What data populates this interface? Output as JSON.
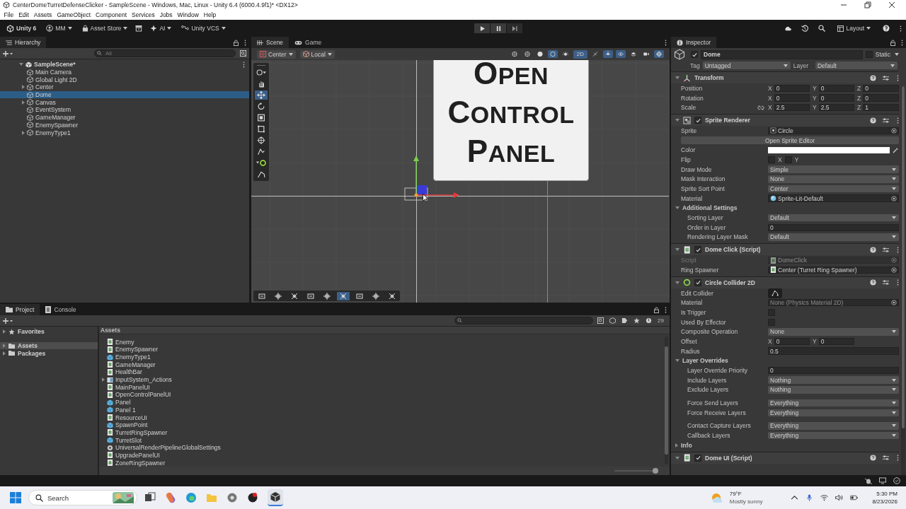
{
  "window": {
    "title": "CenterDomeTurretDefenseClicker - SampleScene - Windows, Mac, Linux - Unity 6.4 (6000.4.9f1)* <DX12>"
  },
  "menu": [
    "File",
    "Edit",
    "Assets",
    "GameObject",
    "Component",
    "Services",
    "Jobs",
    "Window",
    "Help"
  ],
  "toolbar": {
    "product": "Unity 6",
    "account": "MM",
    "asset_store": "Asset Store",
    "ai": "AI",
    "vcs": "Unity VCS",
    "layout": "Layout"
  },
  "hierarchy": {
    "tab": "Hierarchy",
    "search_placeholder": "All",
    "scene": "SampleScene*",
    "items": [
      {
        "name": "Main Camera",
        "selected": false,
        "expandable": false
      },
      {
        "name": "Global Light 2D",
        "selected": false,
        "expandable": false
      },
      {
        "name": "Center",
        "selected": false,
        "expandable": true
      },
      {
        "name": "Dome",
        "selected": true,
        "expandable": false
      },
      {
        "name": "Canvas",
        "selected": false,
        "expandable": true
      },
      {
        "name": "EventSystem",
        "selected": false,
        "expandable": false
      },
      {
        "name": "GameManager",
        "selected": false,
        "expandable": false
      },
      {
        "name": "EnemySpawner",
        "selected": false,
        "expandable": false
      },
      {
        "name": "EnemyType1",
        "selected": false,
        "expandable": true
      }
    ]
  },
  "scene": {
    "tabs": [
      {
        "label": "Scene",
        "selected": true
      },
      {
        "label": "Game",
        "selected": false
      }
    ],
    "pivot": "Center",
    "space": "Local",
    "mode": "2D",
    "sign_lines": [
      "OPEN",
      "CONTROL",
      "PANEL"
    ]
  },
  "inspector": {
    "tab": "Inspector",
    "object": {
      "name": "Dome",
      "active": true,
      "static_label": "Static",
      "static": false
    },
    "tag_label": "Tag",
    "tag": "Untagged",
    "layer_label": "Layer",
    "layer": "Default",
    "components": [
      {
        "kind": "transform",
        "title": "Transform",
        "rows": [
          {
            "kind": "vector",
            "label": "Position",
            "values": [
              {
                "axis": "X",
                "value": "0"
              },
              {
                "axis": "Y",
                "value": "0"
              },
              {
                "axis": "Z",
                "value": "0"
              }
            ]
          },
          {
            "kind": "vector",
            "label": "Rotation",
            "values": [
              {
                "axis": "X",
                "value": "0"
              },
              {
                "axis": "Y",
                "value": "0"
              },
              {
                "axis": "Z",
                "value": "0"
              }
            ]
          },
          {
            "kind": "vector",
            "label": "Scale",
            "constrained": false,
            "values": [
              {
                "axis": "X",
                "value": "2.5"
              },
              {
                "axis": "Y",
                "value": "2.5"
              },
              {
                "axis": "Z",
                "value": "1"
              }
            ]
          }
        ]
      },
      {
        "kind": "sprite_renderer",
        "title": "Sprite Renderer",
        "enabled": true,
        "rows": [
          {
            "kind": "sprite_ref",
            "label": "Sprite",
            "value": "Circle"
          },
          {
            "kind": "button",
            "label": "Open Sprite Editor"
          },
          {
            "kind": "color",
            "label": "Color",
            "color": "#ffffff"
          },
          {
            "kind": "flip",
            "label": "Flip",
            "values": [
              {
                "axis": "X",
                "checked": false
              },
              {
                "axis": "Y",
                "checked": false
              }
            ]
          },
          {
            "kind": "dropdown",
            "label": "Draw Mode",
            "value": "Simple"
          },
          {
            "kind": "dropdown",
            "label": "Mask Interaction",
            "value": "None"
          },
          {
            "kind": "dropdown",
            "label": "Sprite Sort Point",
            "value": "Center"
          },
          {
            "kind": "material_ref",
            "label": "Material",
            "value": "Sprite-Lit-Default"
          },
          {
            "kind": "foldout",
            "label": "Additional Settings",
            "expanded": true,
            "children": [
              {
                "kind": "dropdown",
                "label": "Sorting Layer",
                "value": "Default"
              },
              {
                "kind": "field",
                "label": "Order in Layer",
                "value": "0"
              },
              {
                "kind": "dropdown",
                "label": "Rendering Layer Mask",
                "value": "Default"
              }
            ]
          }
        ]
      },
      {
        "kind": "script",
        "title": "Dome Click (Script)",
        "enabled": true,
        "rows": [
          {
            "kind": "script_ref",
            "label": "Script",
            "value": "DomeClick",
            "disabled": true
          },
          {
            "kind": "script_ref",
            "label": "Ring Spawner",
            "value": "Center (Turret Ring Spawner)",
            "disabled": false
          }
        ]
      },
      {
        "kind": "collider",
        "title": "Circle Collider 2D",
        "enabled": true,
        "rows": [
          {
            "kind": "edit_collider",
            "label": "Edit Collider"
          },
          {
            "kind": "empty_ref",
            "label": "Material",
            "placeholder": "None (Physics Material 2D)"
          },
          {
            "kind": "checkbox",
            "label": "Is Trigger",
            "checked": false
          },
          {
            "kind": "checkbox",
            "label": "Used By Effector",
            "checked": false
          },
          {
            "kind": "dropdown",
            "label": "Composite Operation",
            "value": "None"
          },
          {
            "kind": "vector",
            "label": "Offset",
            "values": [
              {
                "axis": "X",
                "value": "0"
              },
              {
                "axis": "Y",
                "value": "0"
              }
            ]
          },
          {
            "kind": "field",
            "label": "Radius",
            "value": "0.5"
          },
          {
            "kind": "foldout",
            "label": "Layer Overrides",
            "expanded": true,
            "children": [
              {
                "kind": "field",
                "label": "Layer Override Priority",
                "value": "0"
              },
              {
                "kind": "dropdown",
                "label": "Include Layers",
                "value": "Nothing"
              },
              {
                "kind": "dropdown",
                "label": "Exclude Layers",
                "value": "Nothing"
              },
              {
                "kind": "dropdown",
                "label": "Force Send Layers",
                "value": "Everything",
                "spaced": true
              },
              {
                "kind": "dropdown",
                "label": "Force Receive Layers",
                "value": "Everything",
                "spaced": false
              },
              {
                "kind": "dropdown",
                "label": "Contact Capture Layers",
                "value": "Everything",
                "spaced": true
              },
              {
                "kind": "dropdown",
                "label": "Callback Layers",
                "value": "Everything",
                "spaced": false
              }
            ]
          },
          {
            "kind": "foldout",
            "label": "Info",
            "expanded": false
          }
        ]
      },
      {
        "kind": "script",
        "title": "Dome UI (Script)",
        "enabled": true
      }
    ]
  },
  "project": {
    "tabs": [
      {
        "label": "Project",
        "selected": true,
        "kind": "folder"
      },
      {
        "label": "Console",
        "selected": false,
        "kind": "console"
      }
    ],
    "tree": [
      {
        "label": "Favorites",
        "kind": "favorites",
        "selected": false
      },
      {
        "label": "Assets",
        "kind": "folder",
        "selected": true
      },
      {
        "label": "Packages",
        "kind": "folder",
        "selected": false
      }
    ],
    "breadcrumb": "Assets",
    "count": "29",
    "zoom": {
      "level": 1
    },
    "assets": [
      {
        "name": "Enemy",
        "kind": "script",
        "expandable": false
      },
      {
        "name": "EnemySpawner",
        "kind": "script",
        "expandable": false
      },
      {
        "name": "EnemyType1",
        "kind": "prefab",
        "expandable": false
      },
      {
        "name": "GameManager",
        "kind": "script",
        "expandable": false
      },
      {
        "name": "HealthBar",
        "kind": "script",
        "expandable": false
      },
      {
        "name": "InputSystem_Actions",
        "kind": "input",
        "expandable": true
      },
      {
        "name": "MainPanelUI",
        "kind": "script",
        "expandable": false
      },
      {
        "name": "OpenControlPanelUI",
        "kind": "script",
        "expandable": false
      },
      {
        "name": "Panel",
        "kind": "prefab",
        "expandable": false
      },
      {
        "name": "Panel 1",
        "kind": "prefab",
        "expandable": false
      },
      {
        "name": "ResourceUI",
        "kind": "script",
        "expandable": false
      },
      {
        "name": "SpawnPoint",
        "kind": "prefab",
        "expandable": false
      },
      {
        "name": "TurretRingSpawner",
        "kind": "script",
        "expandable": false
      },
      {
        "name": "TurretSlot",
        "kind": "prefab",
        "expandable": false
      },
      {
        "name": "UniversalRenderPipelineGlobalSettings",
        "kind": "settings",
        "expandable": false
      },
      {
        "name": "UpgradePanelUI",
        "kind": "script",
        "expandable": false
      },
      {
        "name": "ZoneRingSpawner",
        "kind": "script",
        "expandable": false
      }
    ]
  },
  "taskbar": {
    "search_placeholder": "Search",
    "temperature": "79°F",
    "weather": "Mostly sunny",
    "time": "5:30 PM",
    "date": "8/23/2026"
  }
}
